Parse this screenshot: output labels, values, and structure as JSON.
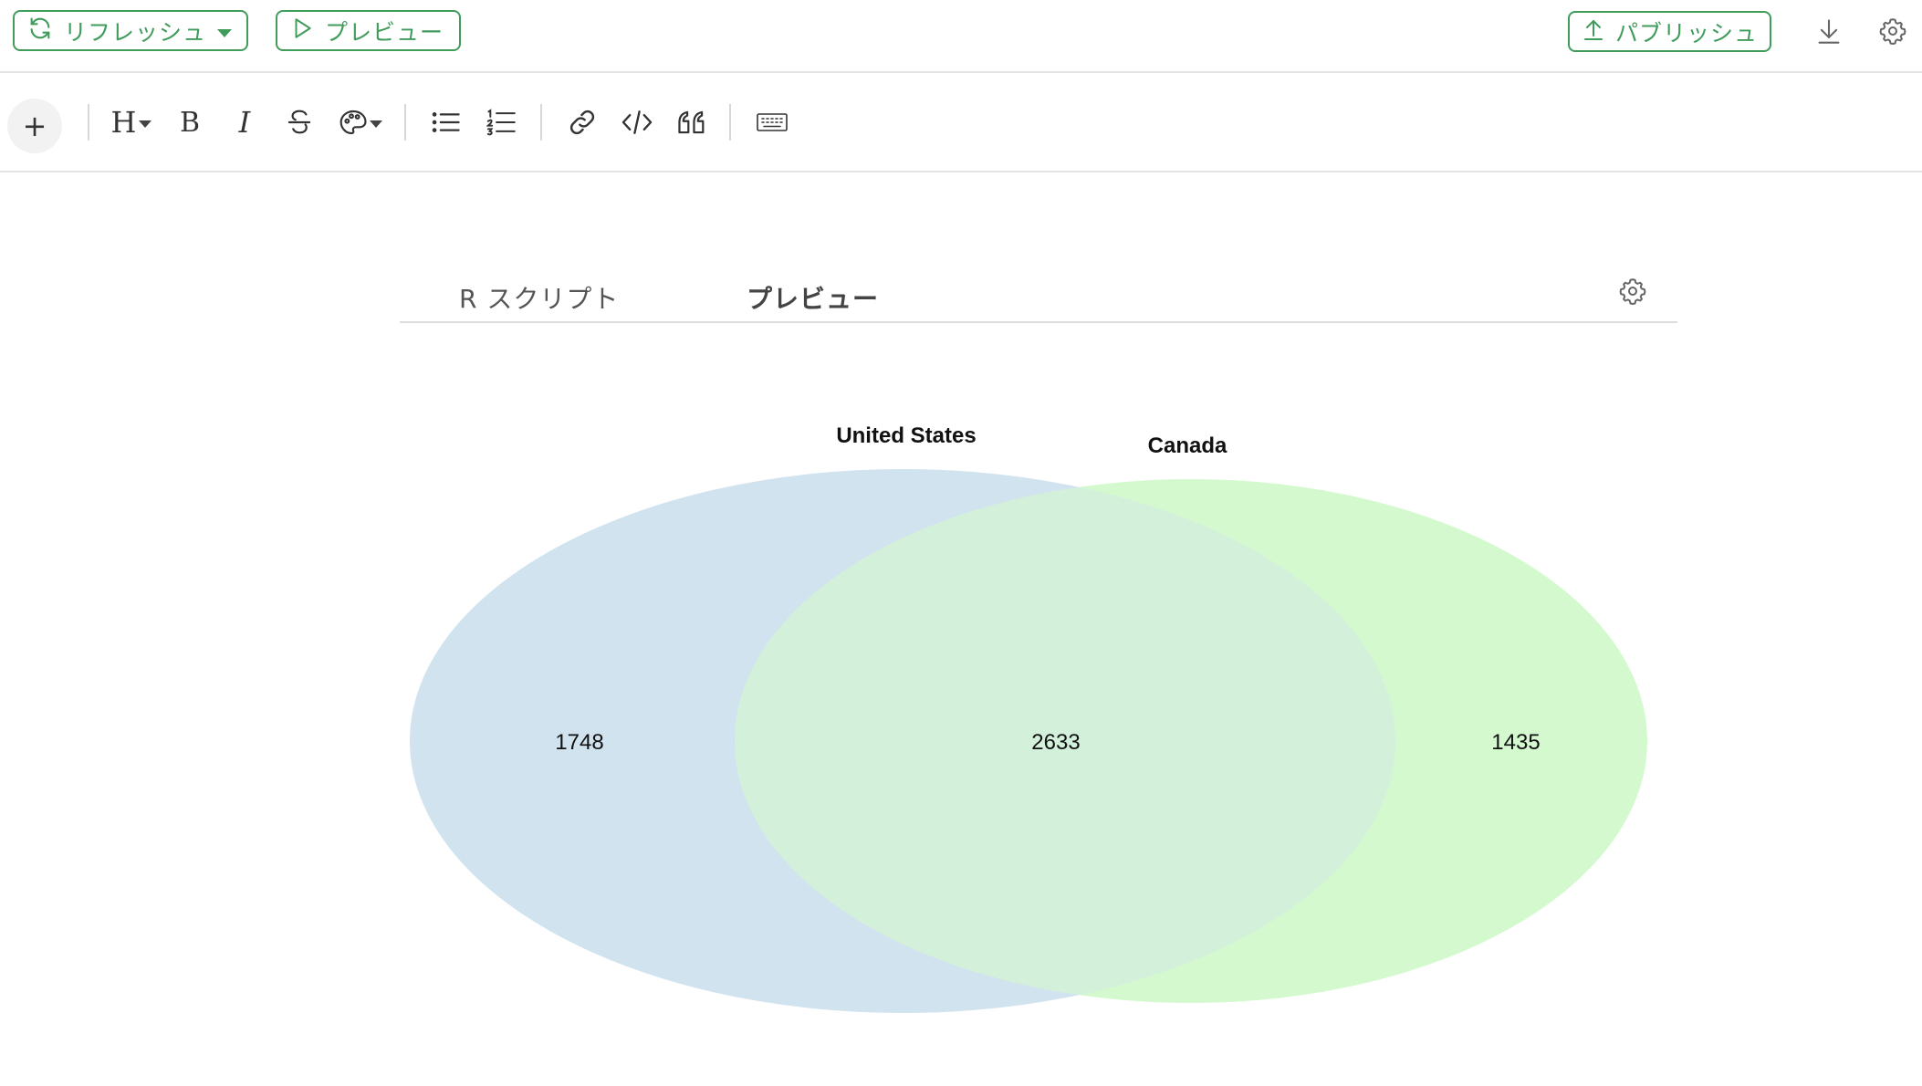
{
  "topbar": {
    "refresh_label": "リフレッシュ",
    "preview_label": "プレビュー",
    "publish_label": "パブリッシュ"
  },
  "icons": {
    "refresh": "refresh-icon",
    "play": "play-icon",
    "upload": "upload-icon",
    "download": "download-icon",
    "settings": "gear-icon"
  },
  "toolbar": {
    "add": "+",
    "heading": "H",
    "bold": "B",
    "italic": "I"
  },
  "tabs": {
    "r_script": "R スクリプト",
    "preview": "プレビュー"
  },
  "colors": {
    "accent": "#3f9c5b",
    "set_a": "#d0e3ee",
    "set_b": "#d4f9cf",
    "overlap": "#d3f0da"
  },
  "chart_data": {
    "type": "venn",
    "sets": [
      {
        "name": "United States",
        "only": 1748
      },
      {
        "name": "Canada",
        "only": 1435
      }
    ],
    "intersection": 2633
  }
}
